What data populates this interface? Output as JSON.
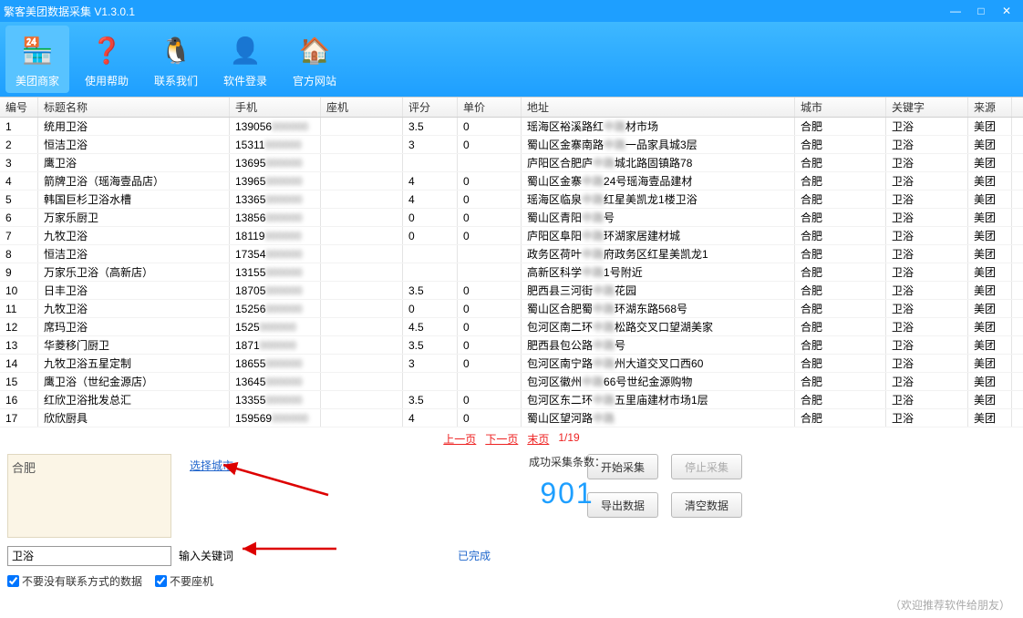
{
  "window": {
    "title": "繁客美团数据采集 V1.3.0.1"
  },
  "toolbar": [
    {
      "label": "美团商家",
      "icon": "🏪",
      "active": true
    },
    {
      "label": "使用帮助",
      "icon": "❓"
    },
    {
      "label": "联系我们",
      "icon": "🐧"
    },
    {
      "label": "软件登录",
      "icon": "👤"
    },
    {
      "label": "官方网站",
      "icon": "🏠"
    }
  ],
  "columns": [
    "编号",
    "标题名称",
    "手机",
    "座机",
    "评分",
    "单价",
    "地址",
    "城市",
    "关键字",
    "来源"
  ],
  "rows": [
    {
      "n": 1,
      "name": "统用卫浴",
      "ph": "139056",
      "rate": "3.5",
      "price": "0",
      "addr1": "瑶海区裕溪路红",
      "addr2": "材市场",
      "city": "合肥",
      "kw": "卫浴",
      "src": "美团"
    },
    {
      "n": 2,
      "name": "恒洁卫浴",
      "ph": "15311",
      "rate": "3",
      "price": "0",
      "addr1": "蜀山区金寨南路",
      "addr2": "一品家具城3层",
      "city": "合肥",
      "kw": "卫浴",
      "src": "美团"
    },
    {
      "n": 3,
      "name": "鹰卫浴",
      "ph": "13695",
      "rate": "",
      "price": "",
      "addr1": "庐阳区合肥庐",
      "addr2": "城北路固镇路78",
      "city": "合肥",
      "kw": "卫浴",
      "src": "美团"
    },
    {
      "n": 4,
      "name": "箭牌卫浴（瑶海壹品店）",
      "ph": "13965",
      "rate": "4",
      "price": "0",
      "addr1": "蜀山区金寨",
      "addr2": "24号瑶海壹品建材",
      "city": "合肥",
      "kw": "卫浴",
      "src": "美团"
    },
    {
      "n": 5,
      "name": "韩国巨杉卫浴水槽",
      "ph": "13365",
      "rate": "4",
      "price": "0",
      "addr1": "瑶海区临泉",
      "addr2": "红星美凯龙1楼卫浴",
      "city": "合肥",
      "kw": "卫浴",
      "src": "美团"
    },
    {
      "n": 6,
      "name": "万家乐厨卫",
      "ph": "13856",
      "rate": "0",
      "price": "0",
      "addr1": "蜀山区青阳",
      "addr2": "号",
      "city": "合肥",
      "kw": "卫浴",
      "src": "美团"
    },
    {
      "n": 7,
      "name": "九牧卫浴",
      "ph": "18119",
      "rate": "0",
      "price": "0",
      "addr1": "庐阳区阜阳",
      "addr2": "环湖家居建材城",
      "city": "合肥",
      "kw": "卫浴",
      "src": "美团"
    },
    {
      "n": 8,
      "name": "恒洁卫浴",
      "ph": "17354",
      "rate": "",
      "price": "",
      "addr1": "政务区荷叶",
      "addr2": "府政务区红星美凯龙1",
      "city": "合肥",
      "kw": "卫浴",
      "src": "美团"
    },
    {
      "n": 9,
      "name": "万家乐卫浴（高新店）",
      "ph": "13155",
      "rate": "",
      "price": "",
      "addr1": "高新区科学",
      "addr2": "1号附近",
      "city": "合肥",
      "kw": "卫浴",
      "src": "美团"
    },
    {
      "n": 10,
      "name": "日丰卫浴",
      "ph": "18705",
      "rate": "3.5",
      "price": "0",
      "addr1": "肥西县三河街",
      "addr2": "花园",
      "city": "合肥",
      "kw": "卫浴",
      "src": "美团"
    },
    {
      "n": 11,
      "name": "九牧卫浴",
      "ph": "15256",
      "rate": "0",
      "price": "0",
      "addr1": "蜀山区合肥蜀",
      "addr2": "环湖东路568号",
      "city": "合肥",
      "kw": "卫浴",
      "src": "美团"
    },
    {
      "n": 12,
      "name": "席玛卫浴",
      "ph": "1525",
      "rate": "4.5",
      "price": "0",
      "addr1": "包河区南二环",
      "addr2": "松路交叉口望湖美家",
      "city": "合肥",
      "kw": "卫浴",
      "src": "美团"
    },
    {
      "n": 13,
      "name": "华菱移门厨卫",
      "ph": "1871",
      "rate": "3.5",
      "price": "0",
      "addr1": "肥西县包公路",
      "addr2": "号",
      "city": "合肥",
      "kw": "卫浴",
      "src": "美团"
    },
    {
      "n": 14,
      "name": "九牧卫浴五星定制",
      "ph": "18655",
      "rate": "3",
      "price": "0",
      "addr1": "包河区南宁路",
      "addr2": "州大道交叉口西60",
      "city": "合肥",
      "kw": "卫浴",
      "src": "美团"
    },
    {
      "n": 15,
      "name": "鹰卫浴（世纪金源店）",
      "ph": "13645",
      "rate": "",
      "price": "",
      "addr1": "包河区徽州",
      "addr2": "66号世纪金源购物",
      "city": "合肥",
      "kw": "卫浴",
      "src": "美团"
    },
    {
      "n": 16,
      "name": "红欣卫浴批发总汇",
      "ph": "13355",
      "rate": "3.5",
      "price": "0",
      "addr1": "包河区东二环",
      "addr2": "五里庙建材市场1层",
      "city": "合肥",
      "kw": "卫浴",
      "src": "美团"
    },
    {
      "n": 17,
      "name": "欣欣厨具",
      "ph": "159569",
      "rate": "4",
      "price": "0",
      "addr1": "蜀山区望河路",
      "addr2": "",
      "city": "合肥",
      "kw": "卫浴",
      "src": "美团"
    }
  ],
  "pager": {
    "prev": "上一页",
    "next": "下一页",
    "last": "末页",
    "page": "1/19"
  },
  "controls": {
    "city": "合肥",
    "city_label": "选择城市",
    "start": "开始采集",
    "stop": "停止采集",
    "export": "导出数据",
    "clear": "清空数据",
    "count_label": "成功采集条数：",
    "count": "901",
    "kw": "卫浴",
    "kw_label": "输入关键词",
    "done": "已完成",
    "chk1": "不要没有联系方式的数据",
    "chk2": "不要座机",
    "recommend": "（欢迎推荐软件给朋友）"
  }
}
